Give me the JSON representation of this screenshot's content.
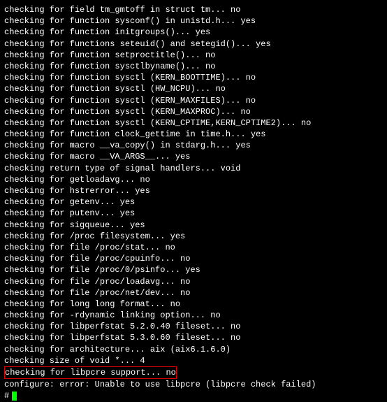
{
  "lines": [
    "checking for field tm_gmtoff in struct tm... no",
    "checking for function sysconf() in unistd.h... yes",
    "checking for function initgroups()... yes",
    "checking for functions seteuid() and setegid()... yes",
    "checking for function setproctitle()... no",
    "checking for function sysctlbyname()... no",
    "checking for function sysctl (KERN_BOOTTIME)... no",
    "checking for function sysctl (HW_NCPU)... no",
    "checking for function sysctl (KERN_MAXFILES)... no",
    "checking for function sysctl (KERN_MAXPROC)... no",
    "checking for function sysctl (KERN_CPTIME,KERN_CPTIME2)... no",
    "checking for function clock_gettime in time.h... yes",
    "checking for macro __va_copy() in stdarg.h... yes",
    "checking for macro __VA_ARGS__... yes",
    "checking return type of signal handlers... void",
    "checking for getloadavg... no",
    "checking for hstrerror... yes",
    "checking for getenv... yes",
    "checking for putenv... yes",
    "checking for sigqueue... yes",
    "checking for /proc filesystem... yes",
    "checking for file /proc/stat... no",
    "checking for file /proc/cpuinfo... no",
    "checking for file /proc/0/psinfo... yes",
    "checking for file /proc/loadavg... no",
    "checking for file /proc/net/dev... no",
    "checking for long long format... no",
    "checking for -rdynamic linking option... no",
    "checking for libperfstat 5.2.0.40 fileset... no",
    "checking for libperfstat 5.3.0.60 fileset... no",
    "checking for architecture... aix (aix6.1.6.0)",
    "checking size of void *... 4"
  ],
  "highlighted_line": "checking for libpcre support... no",
  "error_line": "configure: error: Unable to use libpcre (libpcre check failed)",
  "prompt": "#"
}
